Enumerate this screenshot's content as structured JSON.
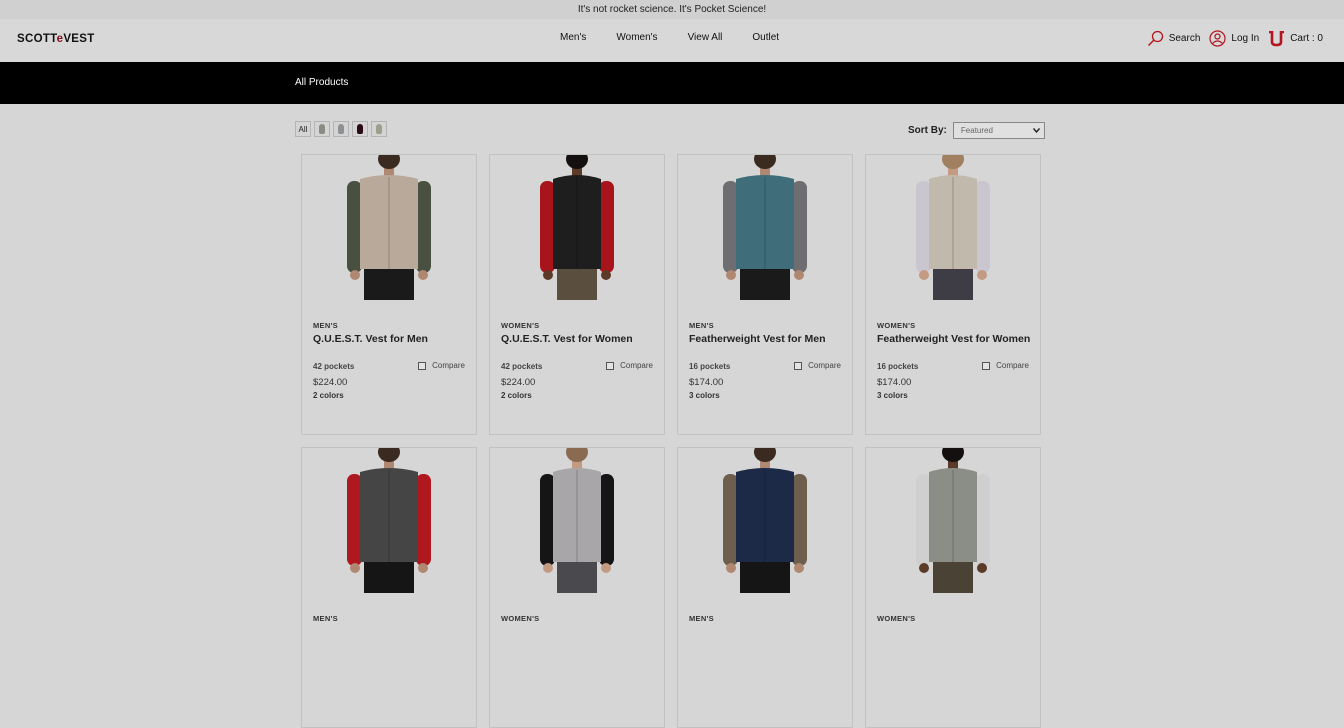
{
  "announcement": "It's not rocket science. It's Pocket Science!",
  "brand": {
    "logo_left": "SCOTT",
    "logo_dot": "e",
    "logo_right": "VEST"
  },
  "nav": [
    "Men's",
    "Women's",
    "View All",
    "Outlet"
  ],
  "utility": {
    "search": "Search",
    "login": "Log In",
    "cart": "Cart : 0"
  },
  "page_title": "All Products",
  "filters": {
    "all_label": "All",
    "swatches": [
      "#8c8a84",
      "#8e9194",
      "#2a0a12",
      "#9ba08c"
    ]
  },
  "sort": {
    "label": "Sort By:",
    "selected": "Featured"
  },
  "products": [
    {
      "category": "MEN'S",
      "name": "Q.U.E.S.T. Vest for Men",
      "pockets": "42 pockets",
      "compare": "Compare",
      "price": "$224.00",
      "colors": "2 colors",
      "vest": "#b8a99a",
      "sleeve": "#4a5040",
      "pants": "#1a1a1a",
      "skin": "#b08770",
      "hair": "#3a2a20"
    },
    {
      "category": "WOMEN'S",
      "name": "Q.U.E.S.T. Vest for Women",
      "pockets": "42 pockets",
      "compare": "Compare",
      "price": "$224.00",
      "colors": "2 colors",
      "vest": "#1e1e1e",
      "sleeve": "#a8141c",
      "pants": "#5a4e3e",
      "skin": "#5c3a28",
      "hair": "#151010"
    },
    {
      "category": "MEN'S",
      "name": "Featherweight Vest for Men",
      "pockets": "16 pockets",
      "compare": "Compare",
      "price": "$174.00",
      "colors": "3 colors",
      "vest": "#3f6e7a",
      "sleeve": "#6e6e72",
      "pants": "#1a1a1a",
      "skin": "#b08770",
      "hair": "#3a2a20"
    },
    {
      "category": "WOMEN'S",
      "name": "Featherweight Vest for Women",
      "pockets": "16 pockets",
      "compare": "Compare",
      "price": "$174.00",
      "colors": "3 colors",
      "vest": "#c2b9ad",
      "sleeve": "#cac6d0",
      "pants": "#3e3c44",
      "skin": "#c49a82",
      "hair": "#a08060"
    },
    {
      "category": "MEN'S",
      "name": "",
      "pockets": "",
      "compare": "",
      "price": "",
      "colors": "",
      "vest": "#454545",
      "sleeve": "#b01820",
      "pants": "#151515",
      "skin": "#b08770",
      "hair": "#3a2a20"
    },
    {
      "category": "WOMEN'S",
      "name": "",
      "pockets": "",
      "compare": "",
      "price": "",
      "colors": "",
      "vest": "#a8a6a8",
      "sleeve": "#151515",
      "pants": "#4a4a4e",
      "skin": "#c49a82",
      "hair": "#8a6a50"
    },
    {
      "category": "MEN'S",
      "name": "",
      "pockets": "",
      "compare": "",
      "price": "",
      "colors": "",
      "vest": "#1c2a48",
      "sleeve": "#6e5e4e",
      "pants": "#151515",
      "skin": "#b08770",
      "hair": "#3a2a20"
    },
    {
      "category": "WOMEN'S",
      "name": "",
      "pockets": "",
      "compare": "",
      "price": "",
      "colors": "",
      "vest": "#8a8e86",
      "sleeve": "#cfcfcf",
      "pants": "#4a4234",
      "skin": "#5c3a28",
      "hair": "#151010"
    }
  ]
}
